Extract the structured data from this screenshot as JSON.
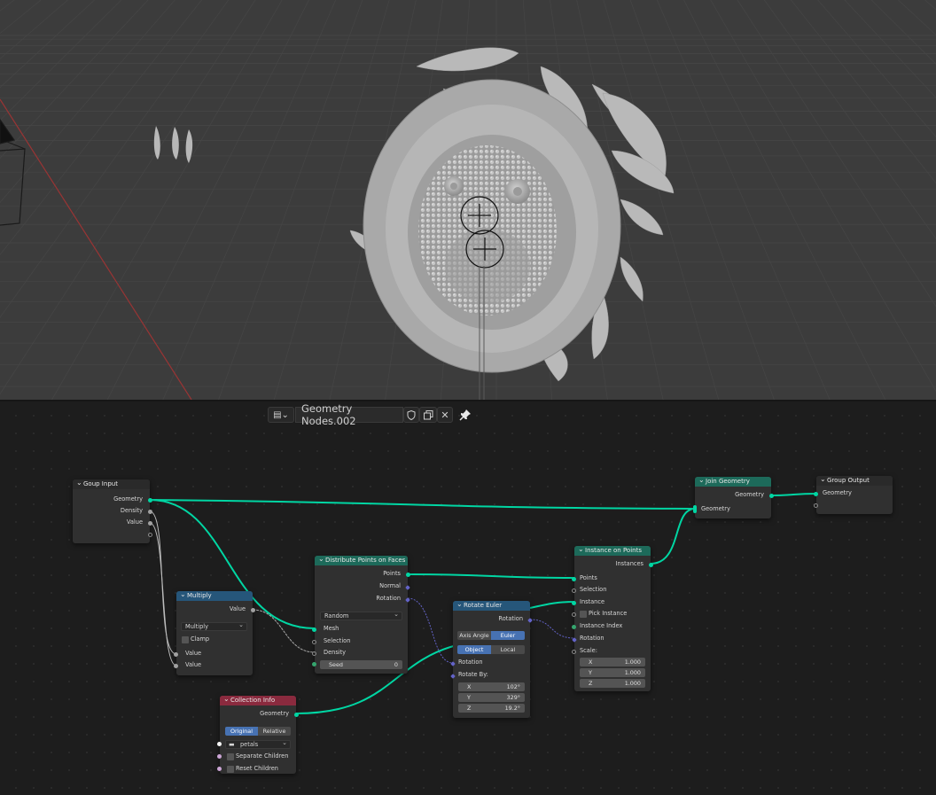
{
  "header": {
    "nodetree_name": "Geometry Nodes.002",
    "icons": [
      "editor-type-icon",
      "shield-icon",
      "duplicate-icon",
      "close-icon",
      "pin-icon"
    ]
  },
  "colors": {
    "geometry_socket": "#00d6a3",
    "float_socket": "#a1a1a1",
    "vector_socket": "#6363c7",
    "geometry_node_header": "#1d6a5a",
    "converter_node_header": "#26567a",
    "input_node_header": "#8a2a3e"
  },
  "nodes": {
    "group_input": {
      "title": "Goup Input",
      "outputs": [
        "Geometry",
        "Density",
        "Value"
      ]
    },
    "multiply": {
      "title": "Multiply",
      "output": "Value",
      "operation": "Multiply",
      "clamp_label": "Clamp",
      "inputs": [
        "Value",
        "Value"
      ]
    },
    "distribute": {
      "title": "Distribute Points on Faces",
      "outputs": [
        "Points",
        "Normal",
        "Rotation"
      ],
      "mode": "Random",
      "inputs": [
        "Mesh",
        "Selection",
        "Density"
      ],
      "seed_label": "Seed",
      "seed_value": "0"
    },
    "collection_info": {
      "title": "Collection Info",
      "output": "Geometry",
      "opt_original": "Original",
      "opt_relative": "Relative",
      "collection": "petals",
      "separate_children": "Separate Children",
      "reset_children": "Reset Children"
    },
    "rotate_euler": {
      "title": "Rotate Euler",
      "output": "Rotation",
      "opt_axis_angle": "Axis Angle",
      "opt_euler": "Euler",
      "opt_object": "Object",
      "opt_local": "Local",
      "input_rotation": "Rotation",
      "rotate_by": "Rotate By:",
      "x_label": "X",
      "x": "102°",
      "y_label": "Y",
      "y": "329°",
      "z_label": "Z",
      "z": "19.2°"
    },
    "instance_on_points": {
      "title": "Instance on Points",
      "output": "Instances",
      "inputs": [
        "Points",
        "Selection",
        "Instance",
        "Pick Instance",
        "Instance Index",
        "Rotation",
        "Scale:"
      ],
      "scale_x_label": "X",
      "scale_x": "1.000",
      "scale_y_label": "Y",
      "scale_y": "1.000",
      "scale_z_label": "Z",
      "scale_z": "1.000"
    },
    "join_geometry": {
      "title": "Join Geometry",
      "output": "Geometry",
      "input": "Geometry"
    },
    "group_output": {
      "title": "Group Output",
      "input": "Geometry"
    }
  }
}
